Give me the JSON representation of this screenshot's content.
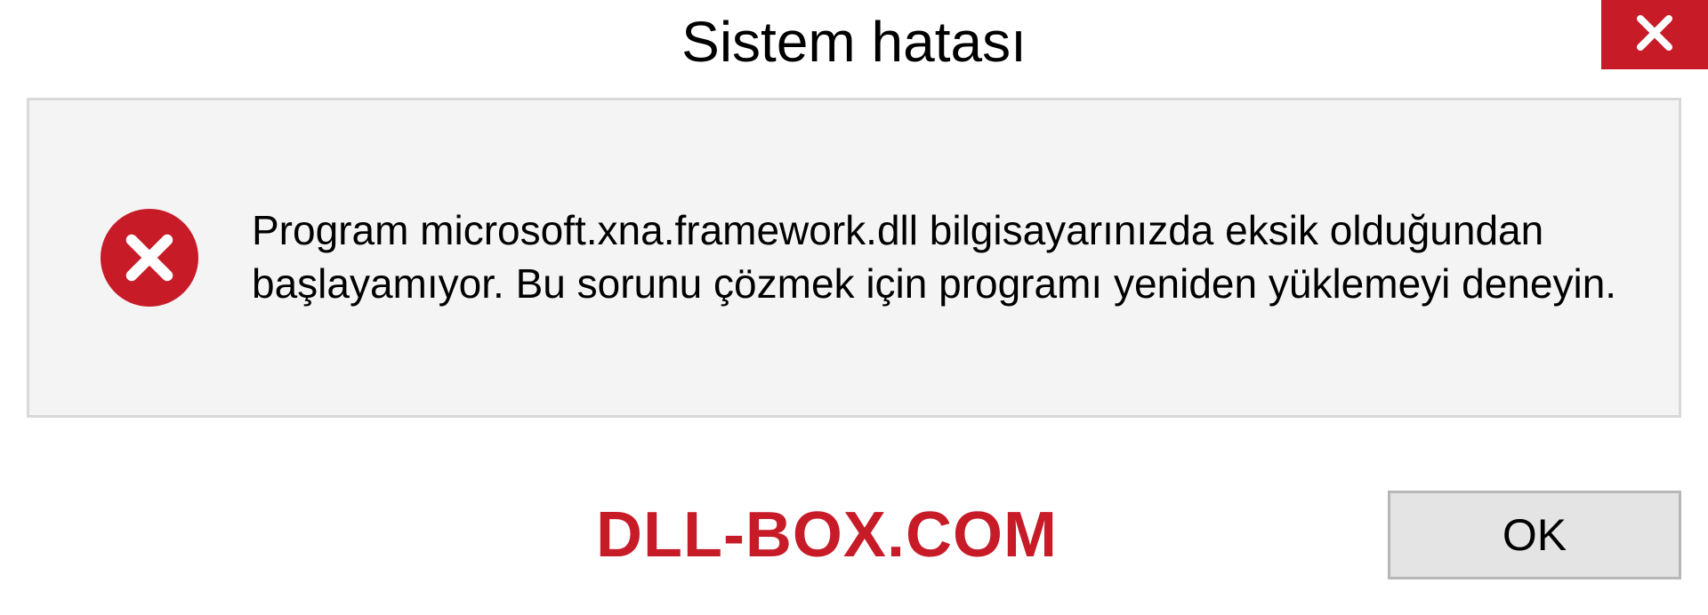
{
  "dialog": {
    "title": "Sistem hatası",
    "message": "Program microsoft.xna.framework.dll bilgisayarınızda eksik olduğundan başlayamıyor. Bu sorunu çözmek için programı yeniden yüklemeyi deneyin.",
    "ok_label": "OK"
  },
  "watermark": "DLL-BOX.COM",
  "colors": {
    "error_red": "#c71b28",
    "panel_bg": "#f4f4f4",
    "panel_border": "#d9d9d9",
    "button_bg": "#e4e4e4",
    "button_border": "#b7b7b7"
  }
}
